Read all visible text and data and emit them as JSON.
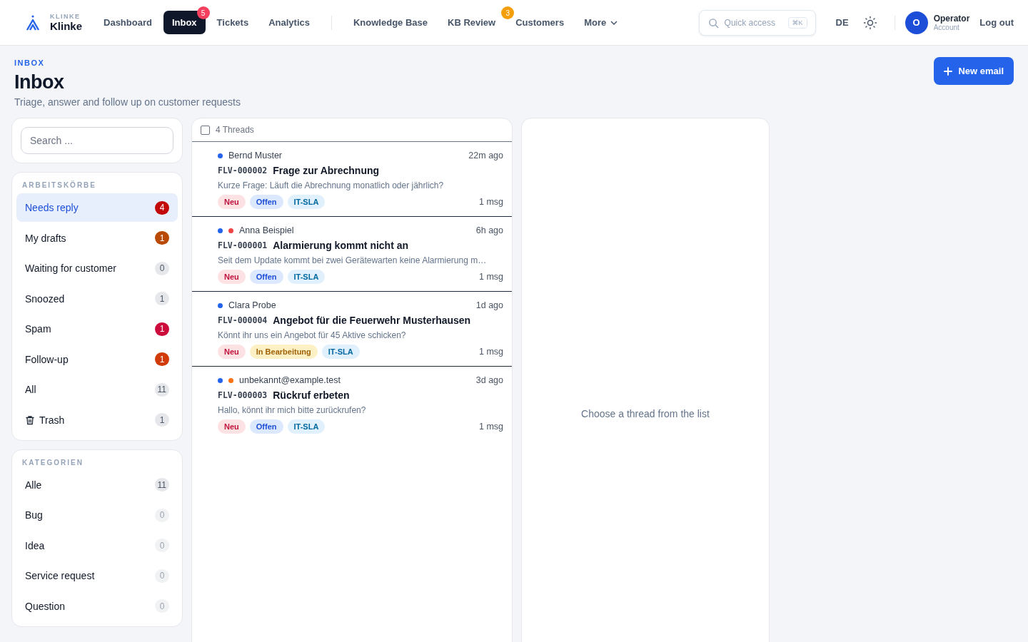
{
  "brand": {
    "overline": "KLINKE",
    "name": "Klinke"
  },
  "nav_groups": [
    [
      {
        "label": "Dashboard",
        "selected": false
      },
      {
        "label": "Inbox",
        "selected": true,
        "badge": {
          "text": "5",
          "kind": "alert"
        }
      },
      {
        "label": "Tickets",
        "selected": false
      },
      {
        "label": "Analytics",
        "selected": false
      }
    ],
    [
      {
        "label": "Knowledge Base",
        "selected": false
      },
      {
        "label": "KB Review",
        "selected": false,
        "badge": {
          "text": "3",
          "kind": "warning"
        }
      },
      {
        "label": "Customers",
        "selected": false
      },
      {
        "label": "More",
        "selected": false,
        "dropdown": true
      }
    ]
  ],
  "quick_access": {
    "placeholder": "Quick access",
    "shortcut": "⌘K"
  },
  "language": "DE",
  "user": {
    "initial": "O",
    "name": "Operator",
    "role": "Account"
  },
  "logout": "Log out",
  "page": {
    "overline": "INBOX",
    "title": "Inbox",
    "subtitle": "Triage, answer and follow up on customer requests",
    "new_button": "New email"
  },
  "search": {
    "placeholder": "Search ..."
  },
  "queues": {
    "title": "ARBEITSKÖRBE",
    "items": [
      {
        "label": "Needs reply",
        "count": "4",
        "kind": "plain",
        "color": "#c20a0a",
        "selected": true
      },
      {
        "label": "My drafts",
        "count": "1",
        "kind": "plain",
        "color": "#b94a06",
        "selected": false
      },
      {
        "label": "Waiting for customer",
        "count": "0",
        "kind": "plain",
        "color": "#e5e7eb",
        "selected": false
      },
      {
        "label": "Snoozed",
        "count": "1",
        "kind": "plain",
        "color": "#e5e7eb",
        "selected": false
      },
      {
        "label": "Spam",
        "count": "1",
        "kind": "plain",
        "color": "#cc0a3b",
        "selected": false
      },
      {
        "label": "Follow-up",
        "count": "1",
        "kind": "plain",
        "color": "#d03b07",
        "selected": false
      },
      {
        "label": "All",
        "count": "11",
        "kind": "plain",
        "color": "#e5e7eb",
        "selected": false
      },
      {
        "label": "Trash",
        "count": "1",
        "kind": "trash",
        "color": "#e5e7eb",
        "selected": false
      }
    ]
  },
  "categories": {
    "title": "KATEGORIEN",
    "items": [
      {
        "label": "Alle",
        "count": "11",
        "color": "#e5e7eb",
        "selected": false
      },
      {
        "label": "Bug",
        "count": "0",
        "color": "#f1f2f4",
        "selected": false
      },
      {
        "label": "Idea",
        "count": "0",
        "color": "#f1f2f4",
        "selected": false
      },
      {
        "label": "Service request",
        "count": "0",
        "color": "#f1f2f4",
        "selected": false
      },
      {
        "label": "Question",
        "count": "0",
        "color": "#f1f2f4",
        "selected": false
      }
    ]
  },
  "thread_list": {
    "select_all_checked": false,
    "count_label": "4 Threads",
    "threads": [
      {
        "dots": [
          {
            "kind": "unread"
          }
        ],
        "sender": "Bernd Muster",
        "time": "22m ago",
        "id": "FLV-000002",
        "subject": "Frage zur Abrechnung",
        "preview": "Kurze Frage: Läuft die Abrechnung monatlich oder jährlich?",
        "tags": [
          {
            "label": "Neu",
            "kind": "new"
          },
          {
            "label": "Offen",
            "kind": "open"
          },
          {
            "label": "IT-SLA",
            "kind": "sla"
          }
        ],
        "messages": "1 msg"
      },
      {
        "dots": [
          {
            "kind": "unread"
          },
          {
            "kind": "high"
          }
        ],
        "sender": "Anna Beispiel",
        "time": "6h ago",
        "id": "FLV-000001",
        "subject": "Alarmierung kommt nicht an",
        "preview": "Seit dem Update kommt bei zwei Gerätewarten keine Alarmierung m…",
        "tags": [
          {
            "label": "Neu",
            "kind": "new"
          },
          {
            "label": "Offen",
            "kind": "open"
          },
          {
            "label": "IT-SLA",
            "kind": "sla"
          }
        ],
        "messages": "1 msg"
      },
      {
        "dots": [
          {
            "kind": "unread"
          }
        ],
        "sender": "Clara Probe",
        "time": "1d ago",
        "id": "FLV-000004",
        "subject": "Angebot für die Feuerwehr Musterhausen",
        "preview": "Könnt ihr uns ein Angebot für 45 Aktive schicken?",
        "tags": [
          {
            "label": "Neu",
            "kind": "new"
          },
          {
            "label": "In Bearbeitung",
            "kind": "progress"
          },
          {
            "label": "IT-SLA",
            "kind": "sla"
          }
        ],
        "messages": "1 msg"
      },
      {
        "dots": [
          {
            "kind": "unread"
          },
          {
            "kind": "medium"
          }
        ],
        "sender": "unbekannt@example.test",
        "time": "3d ago",
        "id": "FLV-000003",
        "subject": "Rückruf erbeten",
        "preview": "Hallo, könnt ihr mich bitte zurückrufen?",
        "tags": [
          {
            "label": "Neu",
            "kind": "new"
          },
          {
            "label": "Offen",
            "kind": "open"
          },
          {
            "label": "IT-SLA",
            "kind": "sla"
          }
        ],
        "messages": "1 msg"
      }
    ]
  },
  "detail": {
    "empty_text": "Choose a thread from the list"
  }
}
